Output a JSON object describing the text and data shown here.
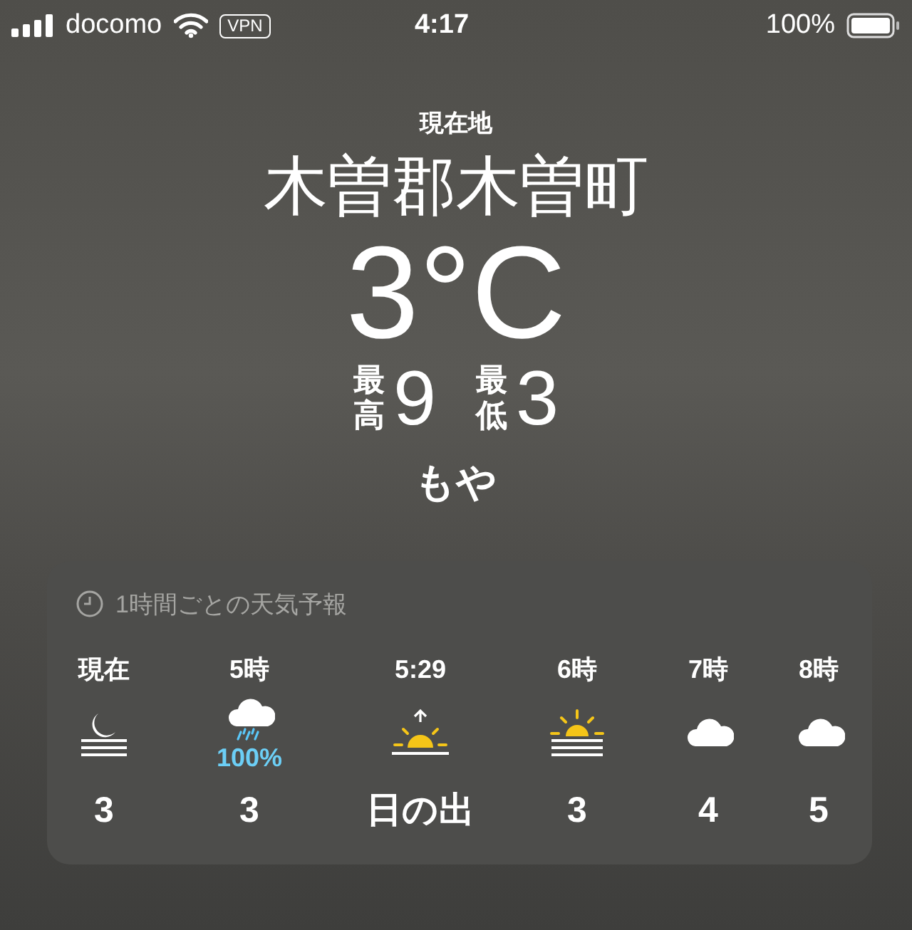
{
  "status_bar": {
    "carrier": "docomo",
    "vpn": "VPN",
    "time": "4:17",
    "battery": "100%"
  },
  "location": {
    "label": "現在地",
    "name": "木曽郡木曽町",
    "temperature": "3°C",
    "high_label": "最高",
    "high": "9",
    "low_label": "最低",
    "low": "3",
    "condition": "もや"
  },
  "hourly": {
    "title": "1時間ごとの天気予報",
    "hours": [
      {
        "time": "現在",
        "kind": "moon-fog",
        "value": "3"
      },
      {
        "time": "5時",
        "kind": "rain",
        "precip": "100%",
        "value": "3"
      },
      {
        "time": "5:29",
        "kind": "sunrise",
        "value": "日の出"
      },
      {
        "time": "6時",
        "kind": "sun-fog",
        "value": "3"
      },
      {
        "time": "7時",
        "kind": "cloud",
        "value": "4"
      },
      {
        "time": "8時",
        "kind": "cloud",
        "value": "5"
      }
    ]
  }
}
